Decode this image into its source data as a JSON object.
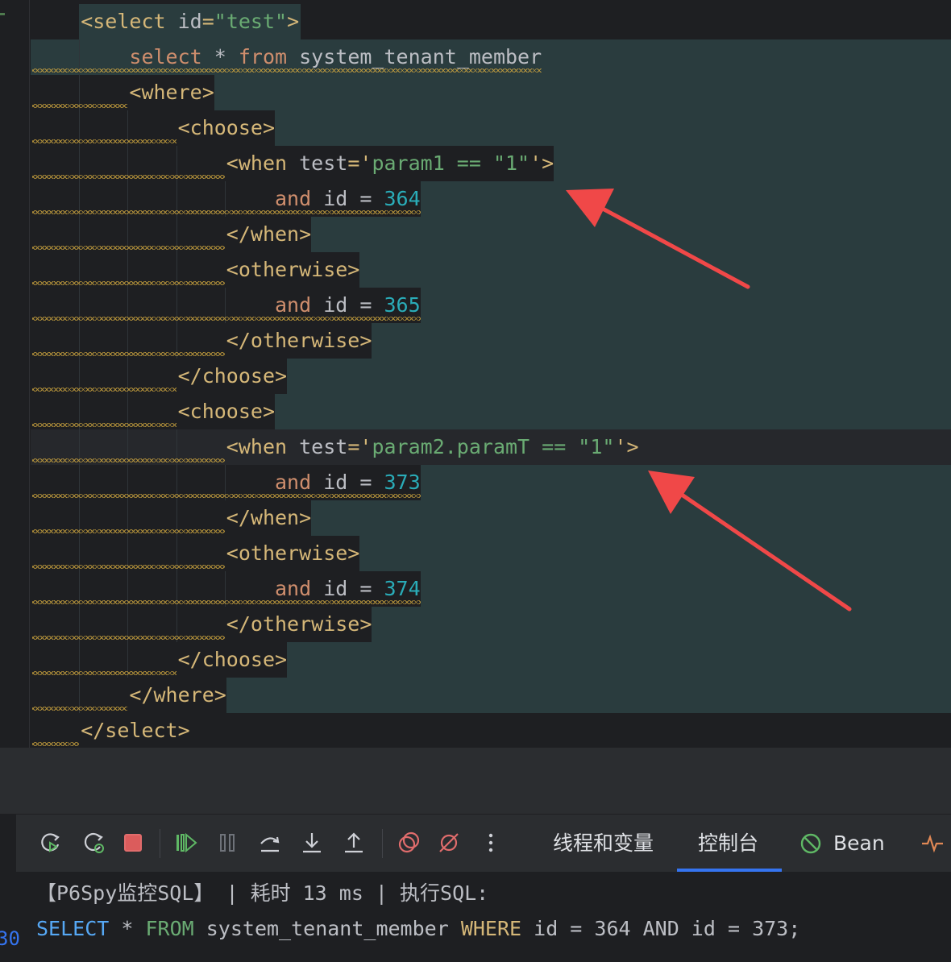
{
  "editor": {
    "lines": [
      {
        "parts": [
          {
            "t": "<select ",
            "c": "tag"
          },
          {
            "t": "id",
            "c": "attr"
          },
          {
            "t": "=",
            "c": "tag"
          },
          {
            "t": "\"test\"",
            "c": "str"
          },
          {
            "t": ">",
            "c": "tag"
          }
        ]
      },
      {
        "parts": [
          {
            "t": "select",
            "c": "kw"
          },
          {
            "t": " * ",
            "c": "attr"
          },
          {
            "t": "from",
            "c": "kw"
          },
          {
            "t": " system_tenant_member",
            "c": "attr"
          }
        ]
      },
      {
        "parts": [
          {
            "t": "<where>",
            "c": "tag"
          }
        ]
      },
      {
        "parts": [
          {
            "t": "<choose>",
            "c": "tag"
          }
        ]
      },
      {
        "parts": [
          {
            "t": "<when ",
            "c": "tag"
          },
          {
            "t": "test",
            "c": "attr"
          },
          {
            "t": "='",
            "c": "tag"
          },
          {
            "t": "param1 == \"1\"",
            "c": "str"
          },
          {
            "t": "'>",
            "c": "tag"
          }
        ]
      },
      {
        "parts": [
          {
            "t": "and",
            "c": "kw"
          },
          {
            "t": " id = ",
            "c": "attr"
          },
          {
            "t": "364",
            "c": "num"
          }
        ]
      },
      {
        "parts": [
          {
            "t": "</when>",
            "c": "tag"
          }
        ]
      },
      {
        "parts": [
          {
            "t": "<otherwise>",
            "c": "tag"
          }
        ]
      },
      {
        "parts": [
          {
            "t": "and",
            "c": "kw"
          },
          {
            "t": " id = ",
            "c": "attr"
          },
          {
            "t": "365",
            "c": "num"
          }
        ]
      },
      {
        "parts": [
          {
            "t": "</otherwise>",
            "c": "tag"
          }
        ]
      },
      {
        "parts": [
          {
            "t": "</choose>",
            "c": "tag"
          }
        ]
      },
      {
        "parts": [
          {
            "t": "<choose>",
            "c": "tag"
          }
        ]
      },
      {
        "parts": [
          {
            "t": "<when ",
            "c": "tag"
          },
          {
            "t": "test",
            "c": "attr"
          },
          {
            "t": "='",
            "c": "tag"
          },
          {
            "t": "param2.paramT == \"1\"",
            "c": "str"
          },
          {
            "t": "'>",
            "c": "tag"
          }
        ]
      },
      {
        "parts": [
          {
            "t": "and",
            "c": "kw"
          },
          {
            "t": " id = ",
            "c": "attr"
          },
          {
            "t": "373",
            "c": "num"
          }
        ]
      },
      {
        "parts": [
          {
            "t": "</when>",
            "c": "tag"
          }
        ]
      },
      {
        "parts": [
          {
            "t": "<otherwise>",
            "c": "tag"
          }
        ]
      },
      {
        "parts": [
          {
            "t": "and",
            "c": "kw"
          },
          {
            "t": " id = ",
            "c": "attr"
          },
          {
            "t": "374",
            "c": "num"
          }
        ]
      },
      {
        "parts": [
          {
            "t": "</otherwise>",
            "c": "tag"
          }
        ]
      },
      {
        "parts": [
          {
            "t": "</choose>",
            "c": "tag"
          }
        ]
      },
      {
        "parts": [
          {
            "t": "</where>",
            "c": "tag"
          }
        ]
      },
      {
        "parts": [
          {
            "t": "</select>",
            "c": "tag"
          }
        ]
      }
    ]
  },
  "toolbar": {
    "buttons": [
      "rerun-icon",
      "rerun-debug-icon",
      "stop-icon",
      "resume-icon",
      "pause-icon",
      "step-over-icon",
      "step-into-icon",
      "step-out-icon",
      "view-breakpoints-icon",
      "mute-breakpoints-icon",
      "more-icon"
    ],
    "tabs": {
      "threads": "线程和变量",
      "console": "控制台",
      "bean": "Bean"
    }
  },
  "console": {
    "log_line": "【P6Spy监控SQL】 | 耗时 13 ms | 执行SQL:",
    "sql": {
      "select": "SELECT",
      "star": " * ",
      "from": "FROM",
      "table": " system_tenant_member ",
      "where": "WHERE",
      "rest": " id = 364 AND id = 373;"
    },
    "line_number": "30"
  },
  "colors": {
    "annotation_arrow": "#f04848",
    "active_tab_underline": "#3574f0"
  }
}
